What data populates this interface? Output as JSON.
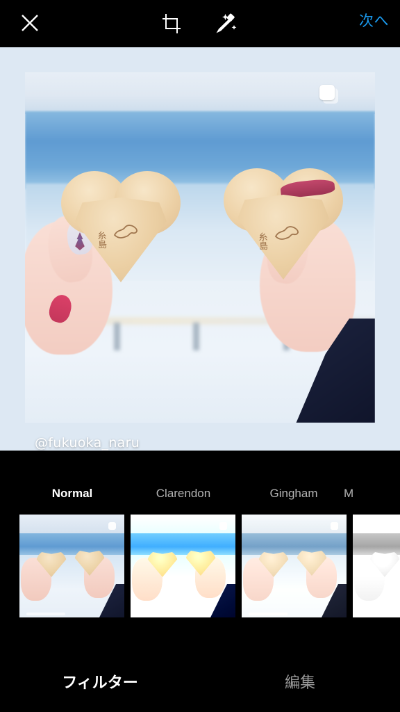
{
  "app": {
    "screen_name": "Instagram Photo Filter Editor",
    "background_color": "#000000",
    "accent_color": "#1a9bf0"
  },
  "topbar": {
    "close_icon": "close-x-icon",
    "crop_icon": "crop-icon",
    "magic_icon": "magic-wand-icon",
    "next_label": "次へ"
  },
  "photo": {
    "watermark": "@fukuoka_naru",
    "multi_photo_icon": "stacked-squares-icon",
    "subject_brand_text": "糸島",
    "stage_background": "#dde8f3"
  },
  "filters": {
    "items": [
      {
        "label": "Normal",
        "selected": true,
        "effect": "none"
      },
      {
        "label": "Clarendon",
        "selected": false,
        "effect": "fx-clarendon"
      },
      {
        "label": "Gingham",
        "selected": false,
        "effect": "fx-gingham"
      },
      {
        "label": "M",
        "selected": false,
        "effect": "fx-moon"
      }
    ]
  },
  "bottom_tabs": {
    "items": [
      {
        "label": "フィルター",
        "selected": true
      },
      {
        "label": "編集",
        "selected": false
      }
    ]
  }
}
